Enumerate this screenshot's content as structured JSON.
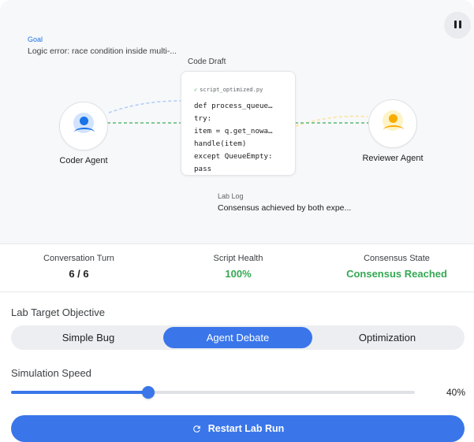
{
  "stage": {
    "goal_label": "Goal",
    "goal_text": "Logic error: race condition inside multi-...",
    "draft_label": "Code Draft",
    "draft_filename": "script_optimized.py",
    "code_lines": [
      "def process_queue…",
      "try:",
      "item = q.get_nowa…",
      "handle(item)",
      "except QueueEmpty:",
      "pass"
    ],
    "coder_name": "Coder Agent",
    "reviewer_name": "Reviewer Agent",
    "log_label": "Lab Log",
    "log_text": "Consensus achieved by both expe..."
  },
  "stats": {
    "turn_label": "Conversation Turn",
    "turn_value": "6 / 6",
    "health_label": "Script Health",
    "health_value": "100%",
    "consensus_label": "Consensus State",
    "consensus_value": "Consensus Reached"
  },
  "controls": {
    "objective_title": "Lab Target Objective",
    "objectives": [
      "Simple Bug",
      "Agent Debate",
      "Optimization"
    ],
    "selected_objective": "Agent Debate",
    "speed_title": "Simulation Speed",
    "speed_value": "40%",
    "speed_fraction": 0.34,
    "restart_label": "Restart Lab Run"
  },
  "colors": {
    "accent": "#3a76ea",
    "success": "#34a853",
    "coder": "#1a73e8",
    "reviewer": "#f9ab00"
  },
  "icons": {
    "pause": "pause-icon",
    "check": "check-icon",
    "coder": "user-icon",
    "reviewer": "user-icon",
    "restart": "refresh-icon"
  }
}
